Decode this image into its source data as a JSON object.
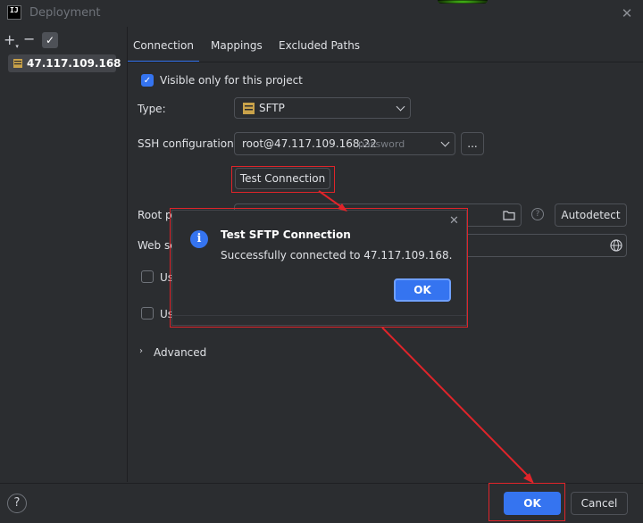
{
  "window": {
    "title": "Deployment",
    "app_logo": "IJ"
  },
  "sidebar": {
    "add_label": "+",
    "remove_label": "−",
    "default_label": "✓",
    "servers": [
      {
        "label": "47.117.109.168",
        "icon": "sftp-server-icon"
      }
    ]
  },
  "tabs": [
    {
      "label": "Connection",
      "active": true
    },
    {
      "label": "Mappings",
      "active": false
    },
    {
      "label": "Excluded Paths",
      "active": false
    }
  ],
  "connection": {
    "visible_only_label": "Visible only for this project",
    "visible_only_checked": true,
    "type_label": "Type:",
    "type_value": "SFTP",
    "type_icon_text": "SFTP",
    "ssh_label": "SSH configuration:",
    "ssh_value": "root@47.117.109.168:22",
    "ssh_hint": "password",
    "ssh_more_label": "...",
    "test_connection_label": "Test Connection",
    "root_path_label": "Root p",
    "autodetect_label": "Autodetect",
    "web_server_label": "Web se",
    "checkbox1_label": "Us",
    "checkbox2_label": "Us",
    "advanced_label": "Advanced"
  },
  "dialog": {
    "title": "Test SFTP Connection",
    "message": "Successfully connected to 47.117.109.168.",
    "ok_label": "OK",
    "close_label": "✕",
    "info_icon": "i"
  },
  "footer": {
    "help_label": "?",
    "ok_label": "OK",
    "cancel_label": "Cancel"
  },
  "colors": {
    "accent": "#3574f0",
    "annotation": "#e0242a",
    "background": "#2b2d30"
  }
}
